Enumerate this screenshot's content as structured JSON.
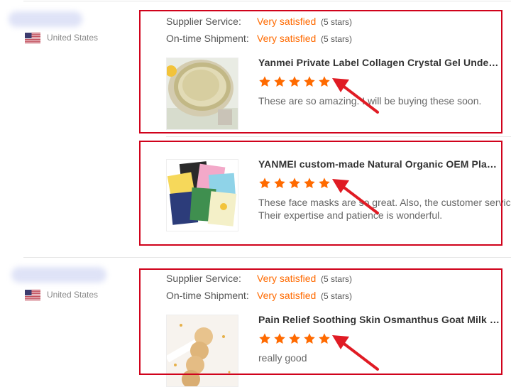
{
  "reviews": [
    {
      "country": "United States",
      "supplier_label": "Supplier Service:",
      "supplier_value": "Very satisfied",
      "supplier_stars": "(5 stars)",
      "shipment_label": "On-time Shipment:",
      "shipment_value": "Very satisfied",
      "shipment_stars": "(5 stars)",
      "items": [
        {
          "title": "Yanmei Private Label Collagen Crystal Gel Under Eye ...",
          "rating": 5,
          "comment_lines": [
            "These are so amazing. I will be buying these soon."
          ]
        },
        {
          "title": "YANMEI custom-made Natural Organic OEM Plant Fru...",
          "rating": 5,
          "comment_lines": [
            "These face masks are so great.  Also, the customer service",
            "Their expertise and patience is wonderful."
          ]
        }
      ]
    },
    {
      "country": "United States",
      "supplier_label": "Supplier Service:",
      "supplier_value": "Very satisfied",
      "supplier_stars": "(5 stars)",
      "shipment_label": "On-time Shipment:",
      "shipment_value": "Very satisfied",
      "shipment_stars": "(5 stars)",
      "items": [
        {
          "title": "Pain Relief Soothing Skin Osmanthus Goat Milk Hand...",
          "rating": 5,
          "comment_lines": [
            "really good"
          ]
        }
      ]
    }
  ],
  "colors": {
    "accent": "#ff6a00",
    "highlight_box": "#d0021b",
    "arrow": "#e01b24"
  }
}
